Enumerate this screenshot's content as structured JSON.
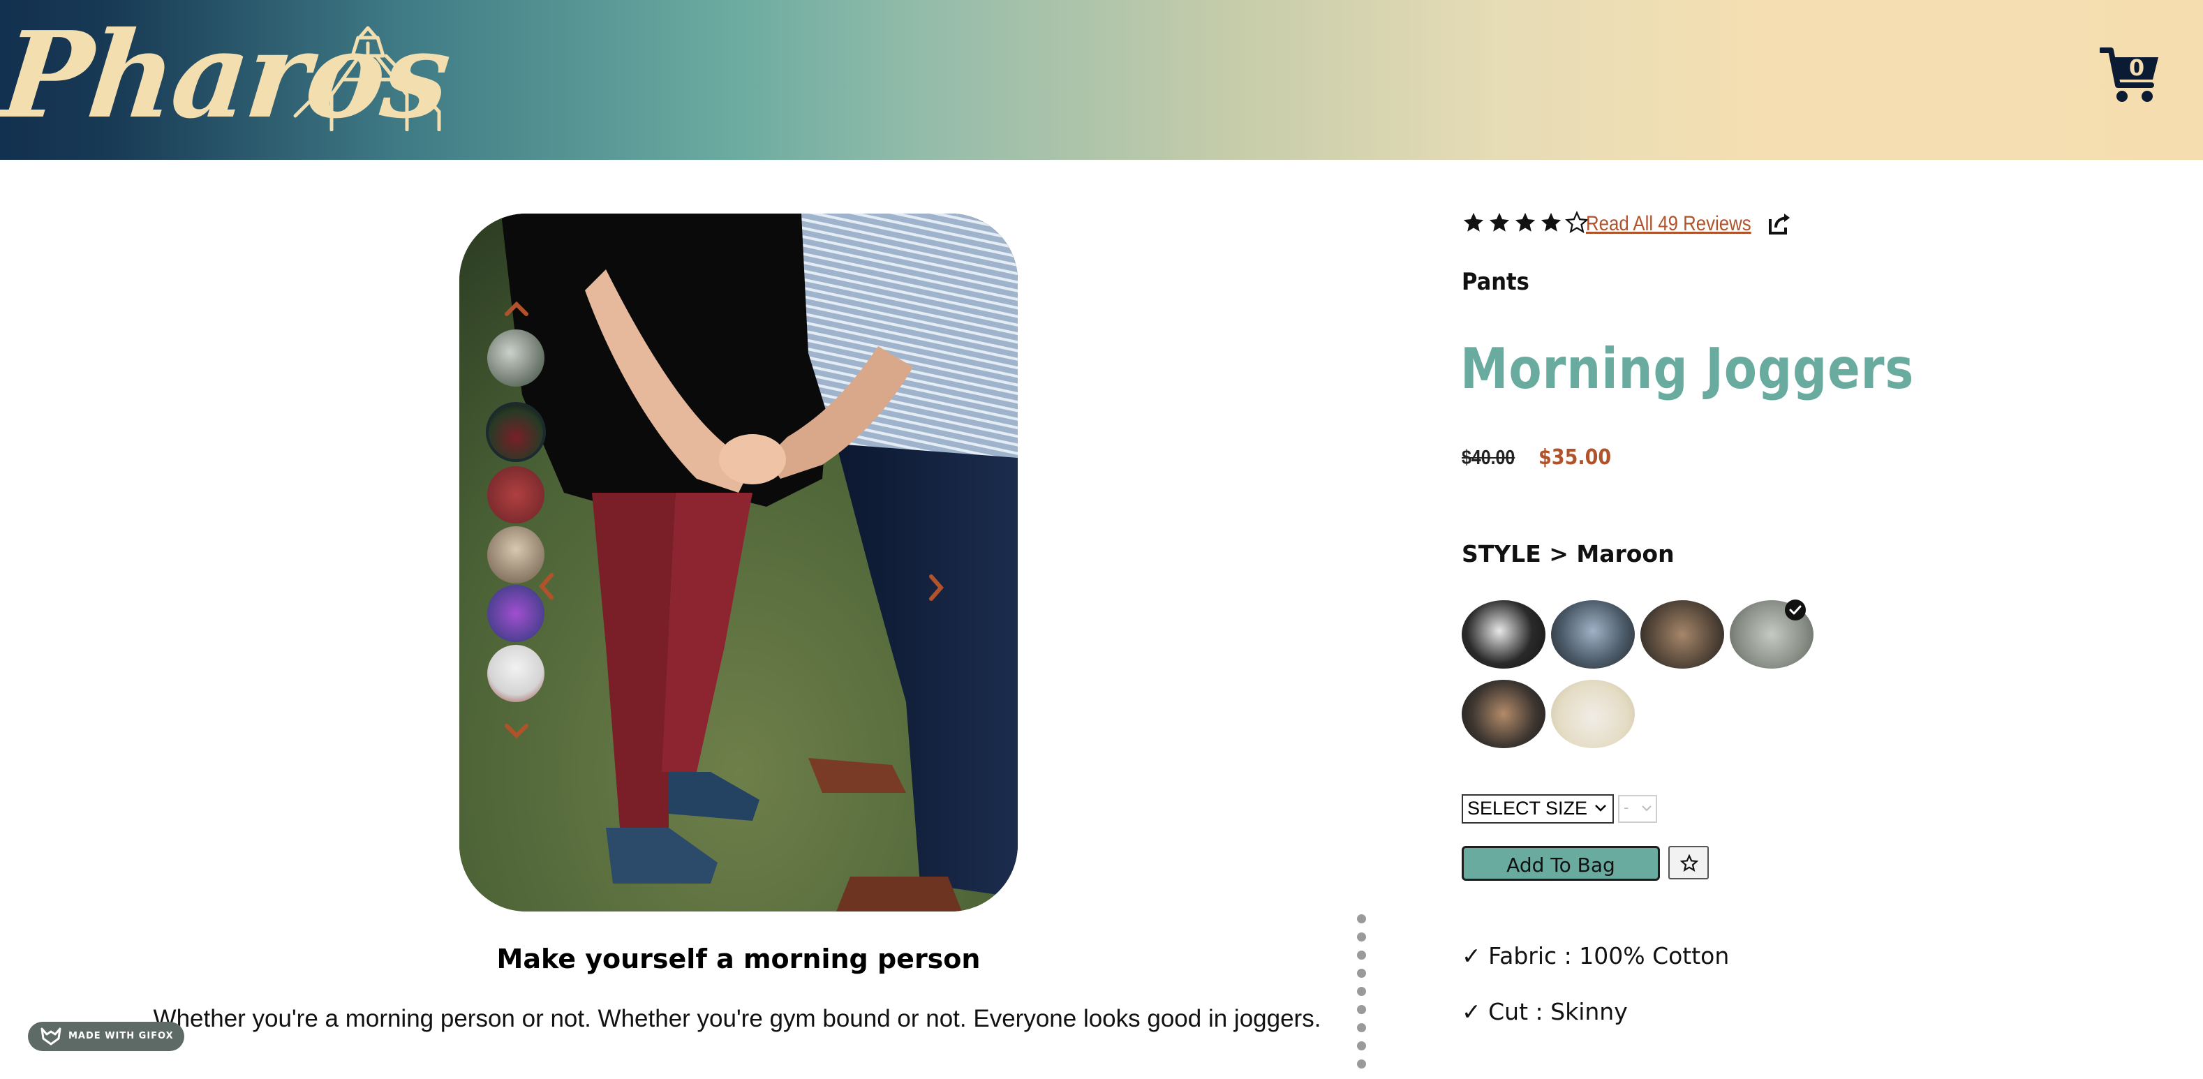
{
  "header": {
    "brand": "Pharos",
    "cart_count": "0"
  },
  "gallery": {
    "caption_title": "Make yourself a morning person",
    "caption_body": "Whether you're a morning person or not. Whether you're gym bound or not. Everyone looks good in joggers.",
    "thumbnail_count": 6,
    "active_thumbnail": 2
  },
  "badge": {
    "text": "MADE WITH GIFOX"
  },
  "product": {
    "rating": 4,
    "rating_max": 5,
    "reviews_link": "Read All 49 Reviews",
    "category": "Pants",
    "title": "Morning Joggers",
    "price_original": "$40.00",
    "price_sale": "$35.00",
    "style_label": "STYLE > Maroon",
    "selected_swatch": 4,
    "size_select": "SELECT SIZE",
    "qty_select": "-",
    "add_to_bag": "Add To Bag",
    "features": [
      "✓ Fabric : 100% Cotton",
      "✓ Cut : Skinny"
    ]
  },
  "colors": {
    "accent_teal": "#6aaba0",
    "accent_rust": "#b0522a",
    "navy": "#12304f",
    "cream": "#f5ddb0"
  }
}
